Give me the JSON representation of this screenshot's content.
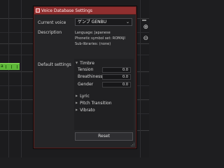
{
  "dialog": {
    "title": "Voice Database Settings",
    "current_voice_label": "Current voice",
    "current_voice_value": "ゲンブ GENBU",
    "description_label": "Description",
    "description_lines": [
      "Language: Japanese",
      "Phonetic symbol set: ROMAJI",
      "Sub-libraries: (none)"
    ],
    "default_settings_label": "Default settings",
    "groups": {
      "timbre": "Timbre",
      "lyric": "Lyric",
      "pitch_transition": "Pitch Transition",
      "vibrato": "Vibrato"
    },
    "params": [
      {
        "label": "Tension",
        "value": "0.0"
      },
      {
        "label": "Breathiness",
        "value": "0.0"
      },
      {
        "label": "Gender",
        "value": "0.0"
      }
    ],
    "reset_label": "Reset"
  },
  "editor": {
    "note_lyric": "a"
  },
  "icons": {
    "app": "app-icon",
    "caret": "chevron-down-icon",
    "expanded": "triangle-down-icon",
    "collapsed": "triangle-right-icon"
  },
  "colors": {
    "titlebar": "#8f2f2f",
    "note": "#5fb93a",
    "dialog_bg": "#252527"
  }
}
